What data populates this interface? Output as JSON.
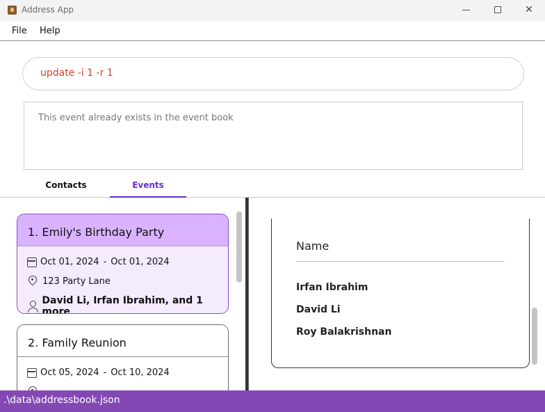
{
  "window": {
    "title": "Address App"
  },
  "menu": {
    "file": "File",
    "help": "Help"
  },
  "command": {
    "value": "update -i 1 -r 1"
  },
  "result": {
    "message": "This event already exists in the event book"
  },
  "tabs": {
    "contacts": "Contacts",
    "events": "Events",
    "active": "Events"
  },
  "events": [
    {
      "header": "1. Emily's Birthday Party",
      "start": "Oct 01, 2024",
      "separator": "-",
      "end": "Oct 01, 2024",
      "location": "123 Party Lane",
      "people": "David Li, Irfan Ibrahim, and 1 more",
      "selected": true
    },
    {
      "header": "2. Family Reunion",
      "start": "Oct 05, 2024",
      "separator": "-",
      "end": "Oct 10, 2024"
    }
  ],
  "attendees": {
    "header": "Name",
    "names": [
      "Irfan Ibrahim",
      "David Li",
      "Roy Balakrishnan"
    ]
  },
  "status": {
    "path": ".\\data\\addressbook.json"
  },
  "colors": {
    "accent": "#6a2bd1",
    "selected_card": "#d9b3ff",
    "status_bar": "#8448b4",
    "command_text": "#d5432b"
  }
}
